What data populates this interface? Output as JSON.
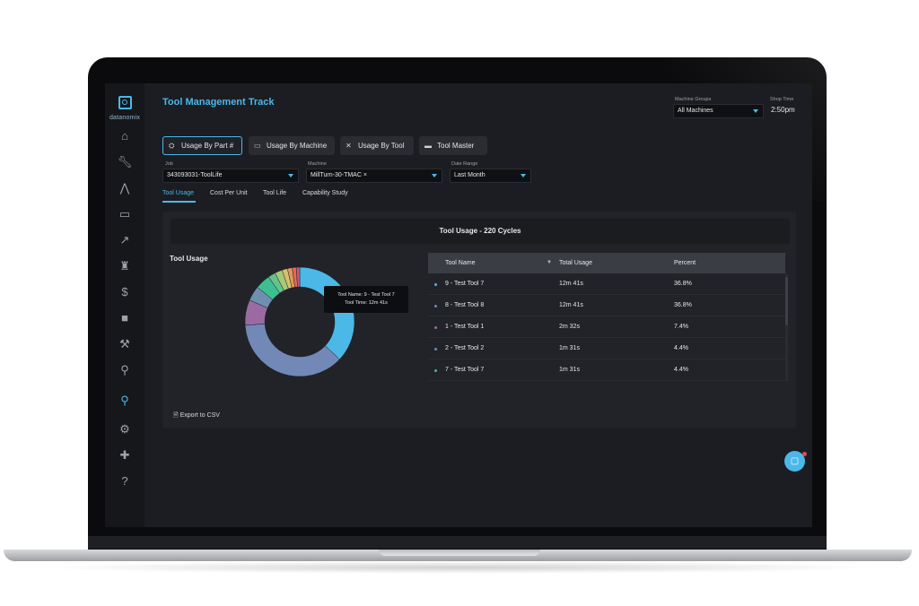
{
  "app": {
    "logo_text": "datanomix",
    "page_title": "Tool Management Track"
  },
  "header": {
    "machine_groups_label": "Machine Groups",
    "machine_groups_value": "All Machines",
    "shop_time_label": "Shop Time",
    "shop_time_value": "2:50pm"
  },
  "sidebar": {
    "icons": [
      "home-icon",
      "wrench-icon",
      "road-icon",
      "monitor-icon",
      "trend-icon",
      "trophy-icon",
      "dollar-icon",
      "truck-icon",
      "worker-icon",
      "search-gear-icon",
      "pin-icon",
      "gear-icon",
      "puzzle-icon",
      "help-icon"
    ],
    "active": "pin-icon"
  },
  "tabs": [
    {
      "label": "Usage By Part #",
      "icon": "parts-icon",
      "active": true
    },
    {
      "label": "Usage By Machine",
      "icon": "monitor-icon",
      "active": false
    },
    {
      "label": "Usage By Tool",
      "icon": "tools-icon",
      "active": false
    },
    {
      "label": "Tool Master",
      "icon": "keyboard-icon",
      "active": false
    }
  ],
  "filters": {
    "job_label": "Job",
    "job_value": "343093031-ToolLife",
    "machine_label": "Machine",
    "machine_value": "MillTurn-30-TMAC ×",
    "date_label": "Date Range",
    "date_value": "Last Month"
  },
  "subtabs": [
    "Tool Usage",
    "Cost Per Unit",
    "Tool Life",
    "Capability Study"
  ],
  "card": {
    "header": "Tool Usage - 220 Cycles",
    "section_title": "Tool Usage",
    "tooltip_line1": "Tool Name: 9 - Test Tool 7",
    "tooltip_line2": "Tool Time: 12m 41s",
    "export_label": "Export to CSV"
  },
  "table": {
    "headers": [
      "Tool Name",
      "Total Usage",
      "Percent"
    ],
    "rows": [
      {
        "name": "9 - Test Tool 7",
        "usage": "12m 41s",
        "percent": "36.8%",
        "color": "#4bb8e8"
      },
      {
        "name": "8 - Test Tool 8",
        "usage": "12m 41s",
        "percent": "36.8%",
        "color": "#7289b8"
      },
      {
        "name": "1 - Test Tool 1",
        "usage": "2m 32s",
        "percent": "7.4%",
        "color": "#9a6ba3"
      },
      {
        "name": "2 - Test Tool 2",
        "usage": "1m 31s",
        "percent": "4.4%",
        "color": "#6f8fb0"
      },
      {
        "name": "7 - Test Tool 7",
        "usage": "1m 31s",
        "percent": "4.4%",
        "color": "#3fbf8f"
      }
    ]
  },
  "chart_data": {
    "type": "pie",
    "title": "Tool Usage",
    "slices": [
      {
        "label": "9 - Test Tool 7",
        "value": 36.8,
        "color": "#4bb8e8"
      },
      {
        "label": "8 - Test Tool 8",
        "value": 36.8,
        "color": "#7289b8"
      },
      {
        "label": "1 - Test Tool 1",
        "value": 7.4,
        "color": "#9a6ba3"
      },
      {
        "label": "2 - Test Tool 2",
        "value": 4.4,
        "color": "#6f8fb0"
      },
      {
        "label": "7 - Test Tool 7",
        "value": 4.4,
        "color": "#3fbf8f"
      },
      {
        "value": 2.2,
        "color": "#64c28a"
      },
      {
        "value": 2.2,
        "color": "#a6c97a"
      },
      {
        "value": 1.6,
        "color": "#d6c26a"
      },
      {
        "value": 1.4,
        "color": "#e0985a"
      },
      {
        "value": 1.2,
        "color": "#df6a5a"
      },
      {
        "value": 1.0,
        "color": "#c85a7a"
      }
    ]
  }
}
